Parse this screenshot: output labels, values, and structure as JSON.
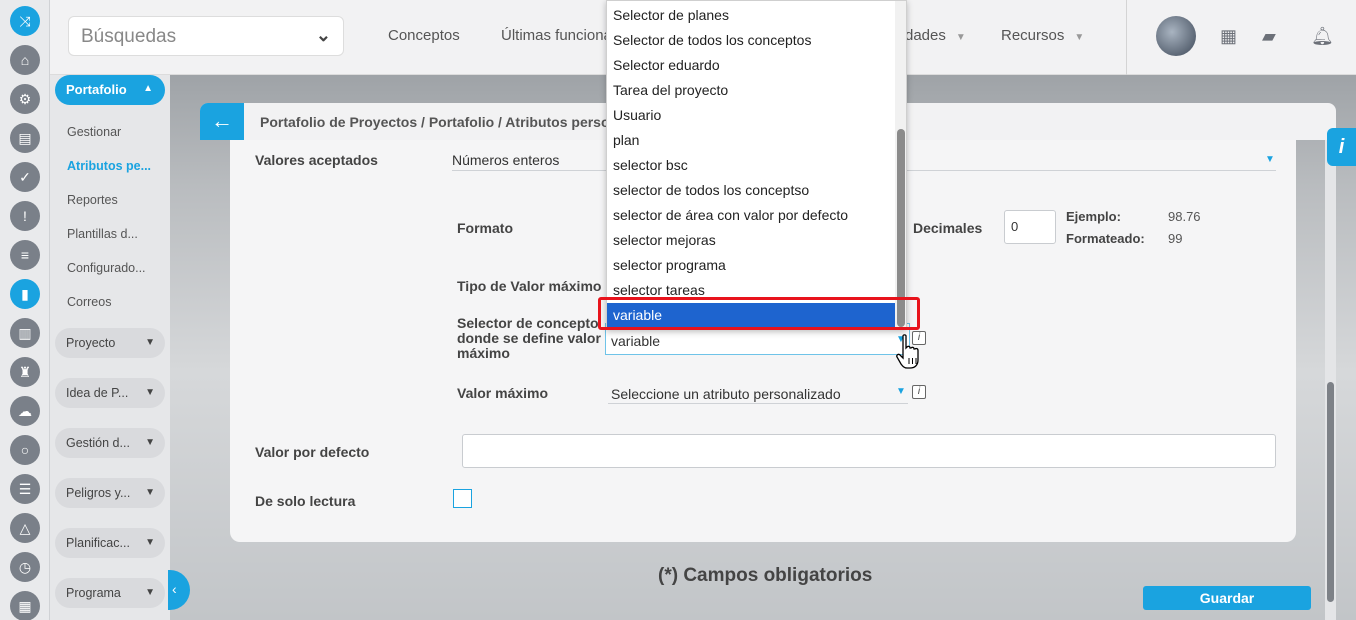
{
  "topbar": {
    "search_placeholder": "Búsquedas",
    "nav": [
      "Conceptos",
      "Últimas funciona",
      "dades",
      "Recursos"
    ]
  },
  "sidebar": {
    "active_section": "Portafolio",
    "sub_items": [
      "Gestionar",
      "Atributos pe...",
      "Reportes",
      "Plantillas d...",
      "Configurado...",
      "Correos"
    ],
    "groups": [
      "Proyecto",
      "Idea de P...",
      "Gestión d...",
      "Peligros y...",
      "Planificac...",
      "Programa"
    ]
  },
  "breadcrumb": "Portafolio de Proyectos / Portafolio / Atributos persona",
  "form": {
    "accepted_values_label": "Valores aceptados",
    "accepted_values_value": "Números enteros",
    "format_label": "Formato",
    "decimals_label": "Decimales",
    "decimals_value": "0",
    "example_label": "Ejemplo:",
    "example_value": "98.76",
    "formatted_label": "Formateado:",
    "formatted_value": "99",
    "max_type_label": "Tipo de Valor máximo",
    "selector_label": "Selector de concepto donde se define valor máximo",
    "selector_value": "variable",
    "max_value_label": "Valor máximo",
    "max_value_value": "Seleccione un atributo personalizado",
    "default_label": "Valor por defecto",
    "default_value": "",
    "readonly_label": "De solo lectura",
    "info_glyph": "i"
  },
  "dropdown_options": [
    "Selector de planes",
    "Selector de todos los conceptos",
    "Selector eduardo",
    "Tarea del proyecto",
    "Usuario",
    "plan",
    "selector bsc",
    "selector de todos los conceptso",
    "selector de área con valor por defecto",
    "selector mejoras",
    "selector programa",
    "selector tareas",
    "variable"
  ],
  "highlighted_option": "variable",
  "required_note": "(*) Campos obligatorios",
  "save_label": "Guardar",
  "info_tab_glyph": "i",
  "colors": {
    "accent": "#1aa3e0",
    "highlight": "#1e64cf",
    "annotation": "#e8131c"
  }
}
